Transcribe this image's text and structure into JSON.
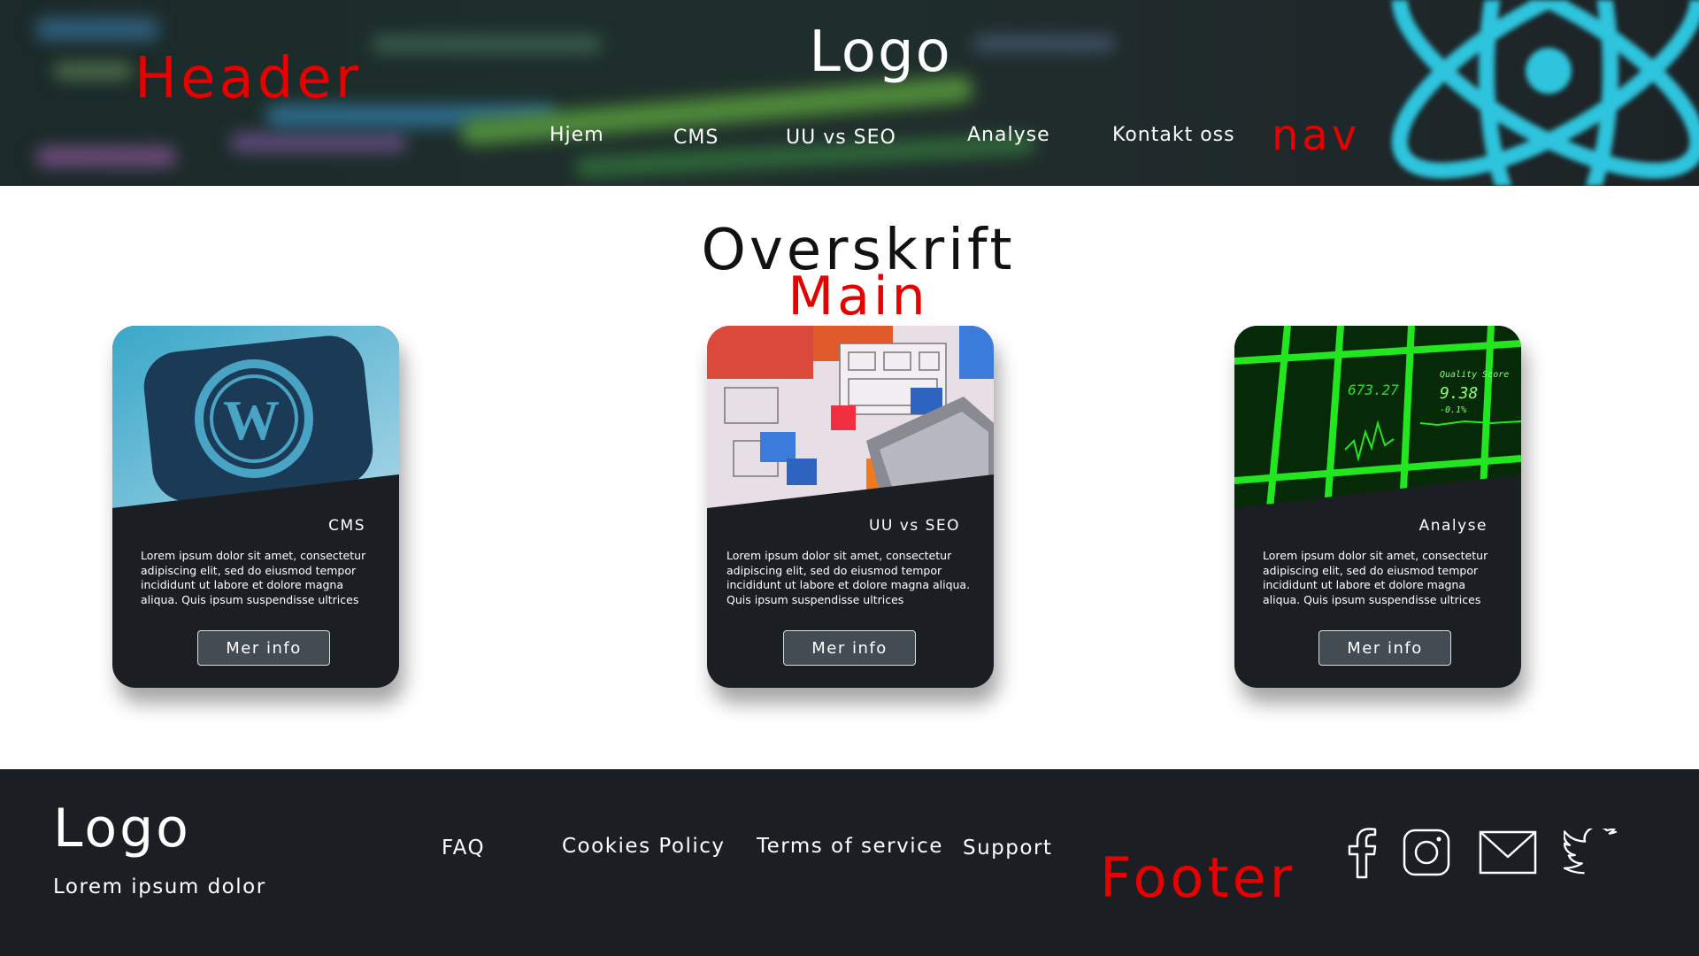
{
  "header": {
    "logo": "Logo",
    "label": "Header",
    "nav_label": "nav",
    "nav": [
      {
        "label": "Hjem"
      },
      {
        "label": "CMS"
      },
      {
        "label": "UU vs SEO"
      },
      {
        "label": "Analyse"
      },
      {
        "label": "Kontakt oss"
      }
    ]
  },
  "main": {
    "title": "Overskrift",
    "label": "Main",
    "cards": [
      {
        "title": "CMS",
        "text": "Lorem ipsum dolor sit amet, consectetur adipiscing elit, sed do eiusmod tempor incididunt ut labore et dolore magna aliqua. Quis ipsum suspendisse ultrices",
        "button": "Mer info"
      },
      {
        "title": "UU vs SEO",
        "text": "Lorem ipsum dolor sit amet, consectetur adipiscing elit, sed do eiusmod tempor incididunt ut labore et dolore magna aliqua. Quis ipsum suspendisse ultrices",
        "button": "Mer info"
      },
      {
        "title": "Analyse",
        "text": "Lorem ipsum dolor sit amet, consectetur adipiscing elit, sed do eiusmod tempor incididunt ut labore et dolore magna aliqua. Quis ipsum suspendisse ultrices",
        "button": "Mer info"
      }
    ],
    "images": {
      "analyse_value": "673.27",
      "analyse_quality_label": "Quality Score",
      "analyse_quality_value": "9.38",
      "analyse_quality_change": "-0.1%"
    }
  },
  "footer": {
    "logo": "Logo",
    "tagline": "Lorem ipsum dolor",
    "label": "Footer",
    "links": [
      {
        "label": "FAQ"
      },
      {
        "label": "Cookies Policy"
      },
      {
        "label": "Terms of service"
      },
      {
        "label": "Support"
      }
    ],
    "social": [
      "facebook-icon",
      "instagram-icon",
      "mail-icon",
      "twitter-icon"
    ]
  },
  "colors": {
    "dark": "#1b1f24",
    "annotation_red": "#e60000",
    "button": "#434c53"
  }
}
